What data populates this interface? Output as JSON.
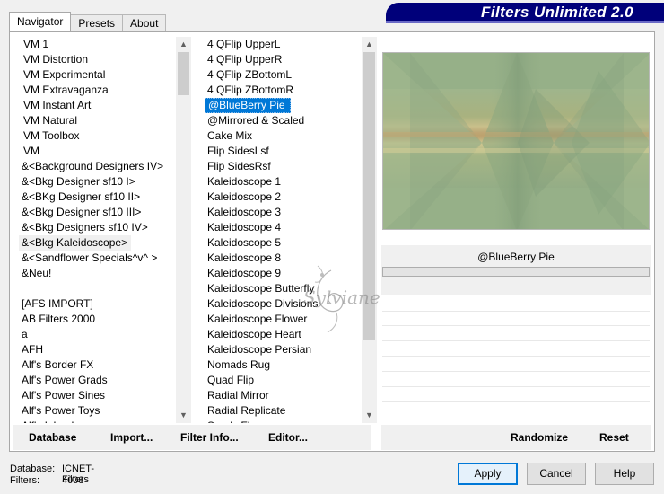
{
  "app": {
    "title": "Filters Unlimited 2.0"
  },
  "tabs": [
    {
      "label": "Navigator",
      "active": true
    },
    {
      "label": "Presets",
      "active": false
    },
    {
      "label": "About",
      "active": false
    }
  ],
  "categories": [
    "VM 1",
    "VM Distortion",
    "VM Experimental",
    "VM Extravaganza",
    "VM Instant Art",
    "VM Natural",
    "VM Toolbox",
    "VM",
    "&<Background Designers IV>",
    "&<Bkg Designer sf10 I>",
    "&<BKg Designer sf10 II>",
    "&<Bkg Designer sf10 III>",
    "&<Bkg Designers sf10 IV>",
    "&<Bkg Kaleidoscope>",
    "&<Sandflower Specials^v^ >",
    "&Neu!",
    "",
    "[AFS IMPORT]",
    "AB Filters 2000",
    "a",
    "AFH",
    "Alf's Border FX",
    "Alf's Power Grads",
    "Alf's Power Sines",
    "Alf's Power Toys",
    "Alf's Inland..."
  ],
  "selected_category": "&<Bkg Kaleidoscope>",
  "filters": [
    "4 QFlip UpperL",
    "4 QFlip UpperR",
    "4 QFlip ZBottomL",
    "4 QFlip ZBottomR",
    "@BlueBerry Pie",
    "@Mirrored & Scaled",
    "Cake Mix",
    "Flip SidesLsf",
    "Flip SidesRsf",
    "Kaleidoscope 1",
    "Kaleidoscope 2",
    "Kaleidoscope 3",
    "Kaleidoscope 4",
    "Kaleidoscope 5",
    "Kaleidoscope 8",
    "Kaleidoscope 9",
    "Kaleidoscope Butterfly",
    "Kaleidoscope Divisions",
    "Kaleidoscope Flower",
    "Kaleidoscope Heart",
    "Kaleidoscope Persian",
    "Nomads Rug",
    "Quad Flip",
    "Radial Mirror",
    "Radial Replicate",
    "Seeds Fl..."
  ],
  "selected_filter": "@BlueBerry Pie",
  "filter_name_display": "@BlueBerry Pie",
  "list_buttons": {
    "database": "Database",
    "import": "Import...",
    "filter_info": "Filter Info...",
    "editor": "Editor..."
  },
  "preview_buttons": {
    "randomize": "Randomize",
    "reset": "Reset"
  },
  "status": {
    "database_label": "Database:",
    "database_value": "ICNET-Filters",
    "filters_label": "Filters:",
    "filters_value": "4008"
  },
  "buttons": {
    "apply": "Apply",
    "cancel": "Cancel",
    "help": "Help"
  },
  "watermark": {
    "text": "Sylviane"
  },
  "colors": {
    "accent": "#0078d7",
    "banner": "#00007a",
    "preview_base": "#96b088"
  }
}
